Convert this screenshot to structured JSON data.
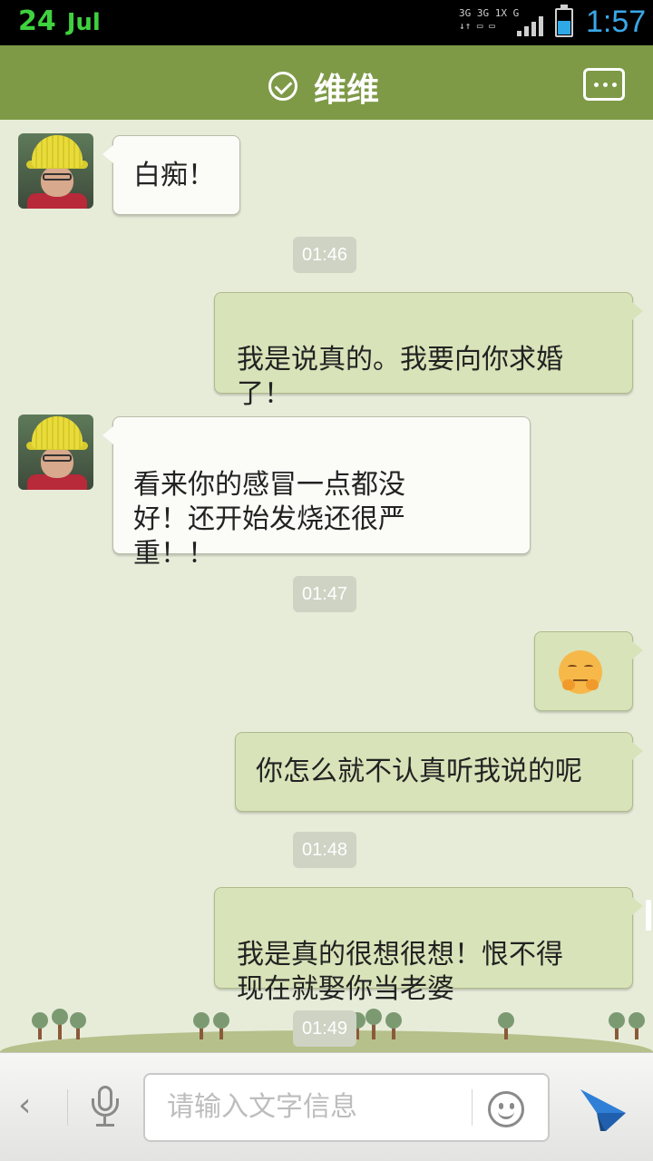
{
  "status_bar": {
    "date_day": "24",
    "date_month": "Jul",
    "network_line1": "3G 3G 1X  G",
    "network_line2": "↓↑ ▭ ▭",
    "battery_level": 0.55,
    "time": "1:57"
  },
  "header": {
    "title": "维维",
    "verified_icon": "check-circle-icon",
    "menu_icon": "more-menu-icon"
  },
  "messages": [
    {
      "from": "friend",
      "text": "白痴！"
    },
    {
      "type": "time",
      "text": "01:46"
    },
    {
      "from": "me",
      "text": "我是说真的。我要向你求婚\n了！"
    },
    {
      "from": "friend",
      "text": "看来你的感冒一点都没\n好！还开始发烧还很严\n重！！"
    },
    {
      "type": "time",
      "text": "01:47"
    },
    {
      "from": "me",
      "emoji": "shy-face-emoji"
    },
    {
      "from": "me",
      "text": "你怎么就不认真听我说的呢"
    },
    {
      "type": "time",
      "text": "01:48"
    },
    {
      "from": "me",
      "text": "我是真的很想很想！恨不得\n现在就娶你当老婆"
    },
    {
      "type": "time",
      "text": "01:49"
    }
  ],
  "input_bar": {
    "back_icon": "chevron-left-icon",
    "voice_icon": "microphone-icon",
    "placeholder": "请输入文字信息",
    "emoji_icon": "smiley-icon",
    "send_icon": "send-icon"
  },
  "colors": {
    "header_green": "#7e9a47",
    "chat_background": "#e7ecd9",
    "outgoing_bubble": "#d8e3b9",
    "incoming_bubble": "#fbfbf7",
    "status_date": "#3fd13f",
    "status_time": "#3aa8e8",
    "send_blue": "#2f7fd6"
  }
}
